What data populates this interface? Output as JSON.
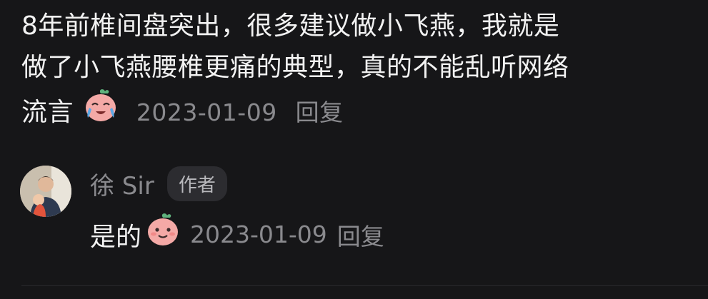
{
  "comment": {
    "line1": "8年前椎间盘突出，很多建议做小飞燕，我就是",
    "line2": "做了小飞燕腰椎更痛的典型，真的不能乱听网络",
    "line3_text": "流言",
    "emoji": "crying-face-emoji",
    "time": "2023-01-09",
    "reply_label": "回复"
  },
  "sub_comment": {
    "author": "徐 Sir",
    "badge": "作者",
    "text": "是的",
    "emoji": "smiling-peach-emoji",
    "time": "2023-01-09",
    "reply_label": "回复"
  },
  "colors": {
    "background": "#161618",
    "text_primary": "#f2f2f2",
    "text_secondary": "#8a8a8e",
    "badge_bg": "#2c2c30"
  }
}
